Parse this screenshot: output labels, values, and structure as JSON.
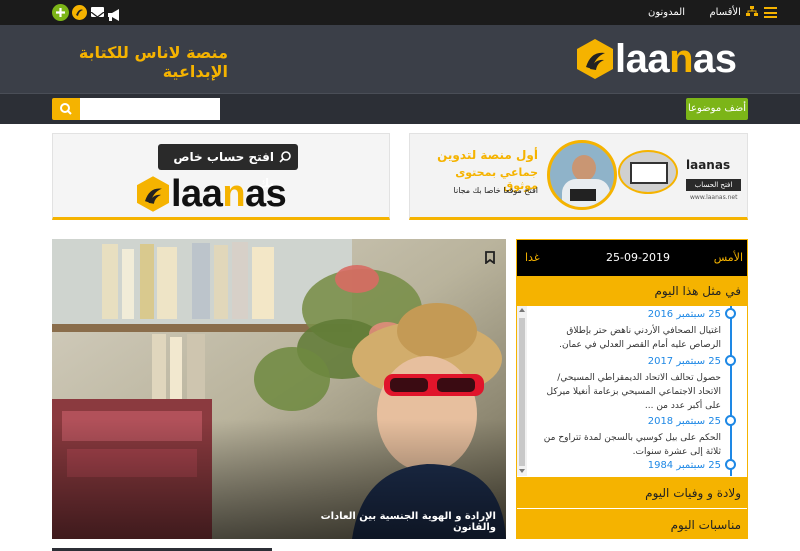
{
  "topbar": {
    "menu_icon": "hamburger-icon",
    "categories_label": "الأقسام",
    "bloggers_label": "المدونون",
    "icons": [
      "plus-circle-icon",
      "laanas-logo-icon",
      "envelope-icon",
      "megaphone-icon"
    ]
  },
  "header": {
    "logo_text_a": "laa",
    "logo_text_n": "n",
    "logo_text_b": "as",
    "tagline": "منصة لاناس للكتابة الإبداعية",
    "accent": "#f5b300"
  },
  "nav": {
    "add_topic_label": "أضف موضوعا",
    "search_placeholder": "",
    "search_icon": "search-icon"
  },
  "banners": {
    "left": {
      "button_label": "افتح حساب خاص بك",
      "logo_text_a": "laa",
      "logo_text_n": "n",
      "logo_text_b": "as"
    },
    "right": {
      "headline_1": "أول منصة لتدوين",
      "headline_2": "جماعي بمحتوى موثوق",
      "sub": "افتح موقعا خاصا بك مجانا",
      "mini_logo": "laanas",
      "mini_button": "افتح الحساب",
      "mini_url": "www.laanas.net"
    }
  },
  "hero": {
    "caption": "الإرادة و الهوية الجنسية بين العادات والقانون",
    "bookmark_icon": "bookmark-icon"
  },
  "widget": {
    "yesterday": "الأمس",
    "date": "25-09-2019",
    "tomorrow": "غدا",
    "section_title": "في مثل هذا اليوم",
    "timeline": [
      {
        "year": "25 سبتمبر 2016",
        "text": "اغتيال الصحافي الأردني ناهض حتر بإطلاق الرصاص عليه أمام القصر العدلي في عمان."
      },
      {
        "year": "25 سبتمبر 2017",
        "text": "حصول تحالف الاتحاد الديمقراطي المسيحي/الاتحاد الاجتماعي المسيحي بزعامة أنغيلا ميركل على أكبر عدد من ..."
      },
      {
        "year": "25 سبتمبر 2018",
        "text": "الحكم على بيل كوسبي بالسجن لمدة تتراوح من ثلاثة إلى عشرة سنوات."
      },
      {
        "year": "25 سبتمبر 1984",
        "text": ""
      }
    ],
    "births_deaths": "ولادة و وفيات اليوم",
    "occasions": "مناسبات اليوم"
  }
}
